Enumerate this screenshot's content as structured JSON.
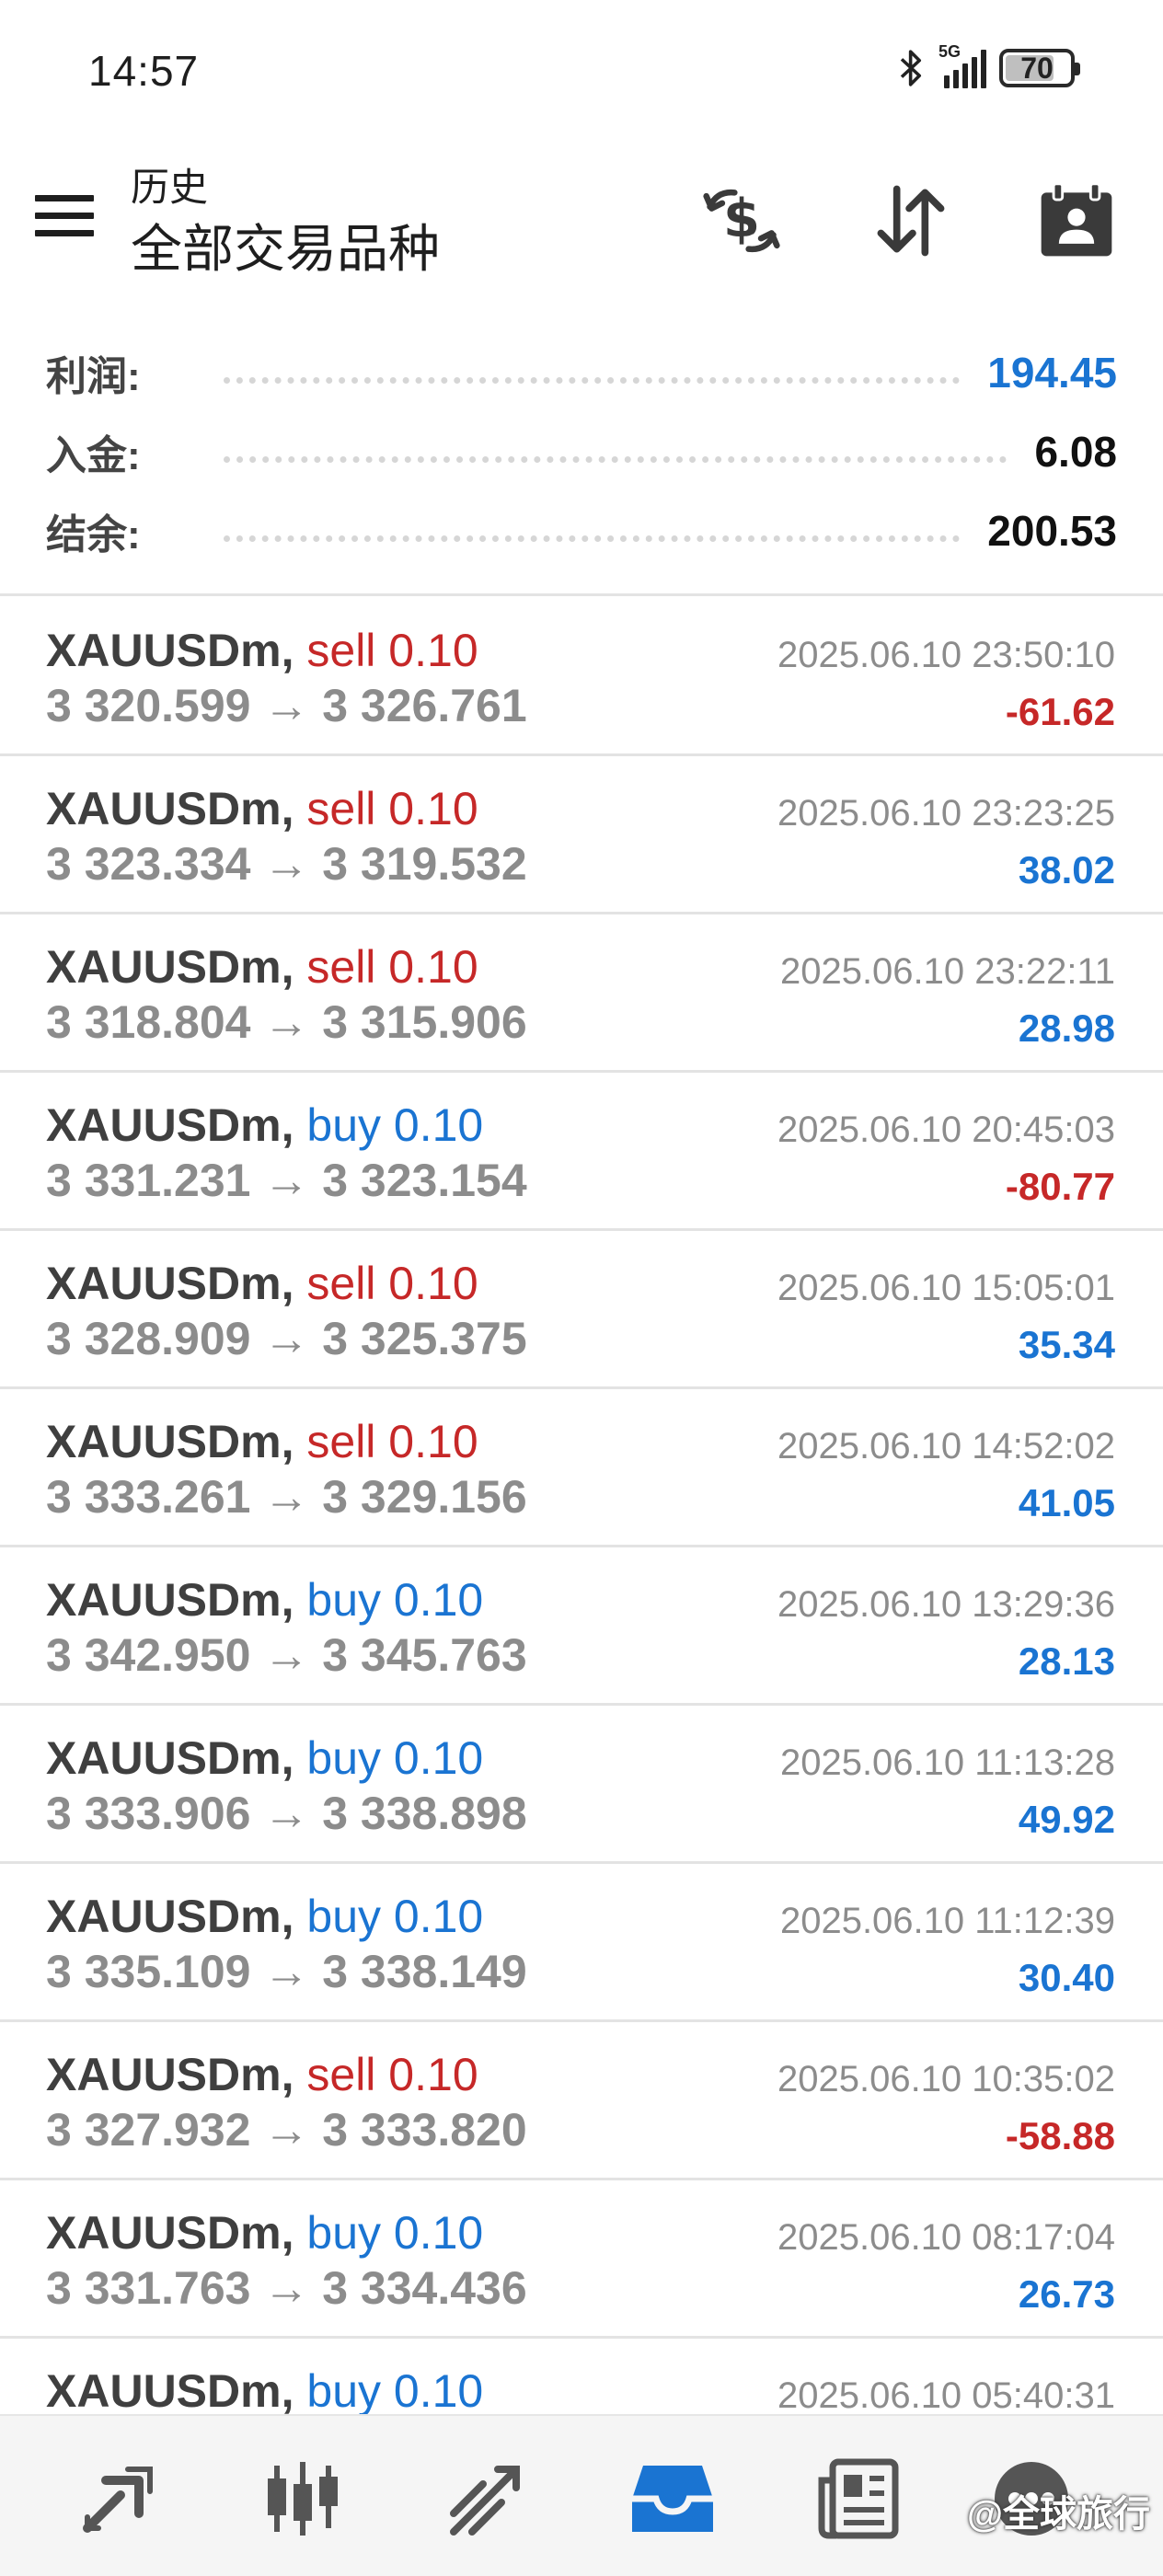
{
  "status_bar": {
    "time": "14:57",
    "network": "5G",
    "battery": "70"
  },
  "header": {
    "subtitle": "历史",
    "title": "全部交易品种"
  },
  "summary": {
    "profit_label": "利润:",
    "profit_value": "194.45",
    "deposit_label": "入金:",
    "deposit_value": "6.08",
    "balance_label": "结余:",
    "balance_value": "200.53"
  },
  "deals": [
    {
      "symbol": "XAUUSDm,",
      "side": "sell 0.10",
      "prices": "3 320.599 → 3 326.761",
      "time": "2025.06.10 23:50:10",
      "profit": "-61.62"
    },
    {
      "symbol": "XAUUSDm,",
      "side": "sell 0.10",
      "prices": "3 323.334 → 3 319.532",
      "time": "2025.06.10 23:23:25",
      "profit": "38.02"
    },
    {
      "symbol": "XAUUSDm,",
      "side": "sell 0.10",
      "prices": "3 318.804 → 3 315.906",
      "time": "2025.06.10 23:22:11",
      "profit": "28.98"
    },
    {
      "symbol": "XAUUSDm,",
      "side": "buy 0.10",
      "prices": "3 331.231 → 3 323.154",
      "time": "2025.06.10 20:45:03",
      "profit": "-80.77"
    },
    {
      "symbol": "XAUUSDm,",
      "side": "sell 0.10",
      "prices": "3 328.909 → 3 325.375",
      "time": "2025.06.10 15:05:01",
      "profit": "35.34"
    },
    {
      "symbol": "XAUUSDm,",
      "side": "sell 0.10",
      "prices": "3 333.261 → 3 329.156",
      "time": "2025.06.10 14:52:02",
      "profit": "41.05"
    },
    {
      "symbol": "XAUUSDm,",
      "side": "buy 0.10",
      "prices": "3 342.950 → 3 345.763",
      "time": "2025.06.10 13:29:36",
      "profit": "28.13"
    },
    {
      "symbol": "XAUUSDm,",
      "side": "buy 0.10",
      "prices": "3 333.906 → 3 338.898",
      "time": "2025.06.10 11:13:28",
      "profit": "49.92"
    },
    {
      "symbol": "XAUUSDm,",
      "side": "buy 0.10",
      "prices": "3 335.109 → 3 338.149",
      "time": "2025.06.10 11:12:39",
      "profit": "30.40"
    },
    {
      "symbol": "XAUUSDm,",
      "side": "sell 0.10",
      "prices": "3 327.932 → 3 333.820",
      "time": "2025.06.10 10:35:02",
      "profit": "-58.88"
    },
    {
      "symbol": "XAUUSDm,",
      "side": "buy 0.10",
      "prices": "3 331.763 → 3 334.436",
      "time": "2025.06.10 08:17:04",
      "profit": "26.73"
    },
    {
      "symbol": "XAUUSDm,",
      "side": "buy 0.10",
      "prices": "",
      "time": "2025.06.10 05:40:31",
      "profit": ""
    }
  ],
  "colors": {
    "sell": "#c62828",
    "buy": "#1a74d2",
    "loss": "#c62828",
    "gain": "#1a74d2",
    "active_tab": "#1a74d2"
  },
  "bottom_nav": {
    "items": [
      "quotes-icon",
      "chart-icon",
      "trade-icon",
      "history-icon",
      "news-icon",
      "messages-icon"
    ],
    "active": "history-icon"
  },
  "watermark": "@全球旅行"
}
